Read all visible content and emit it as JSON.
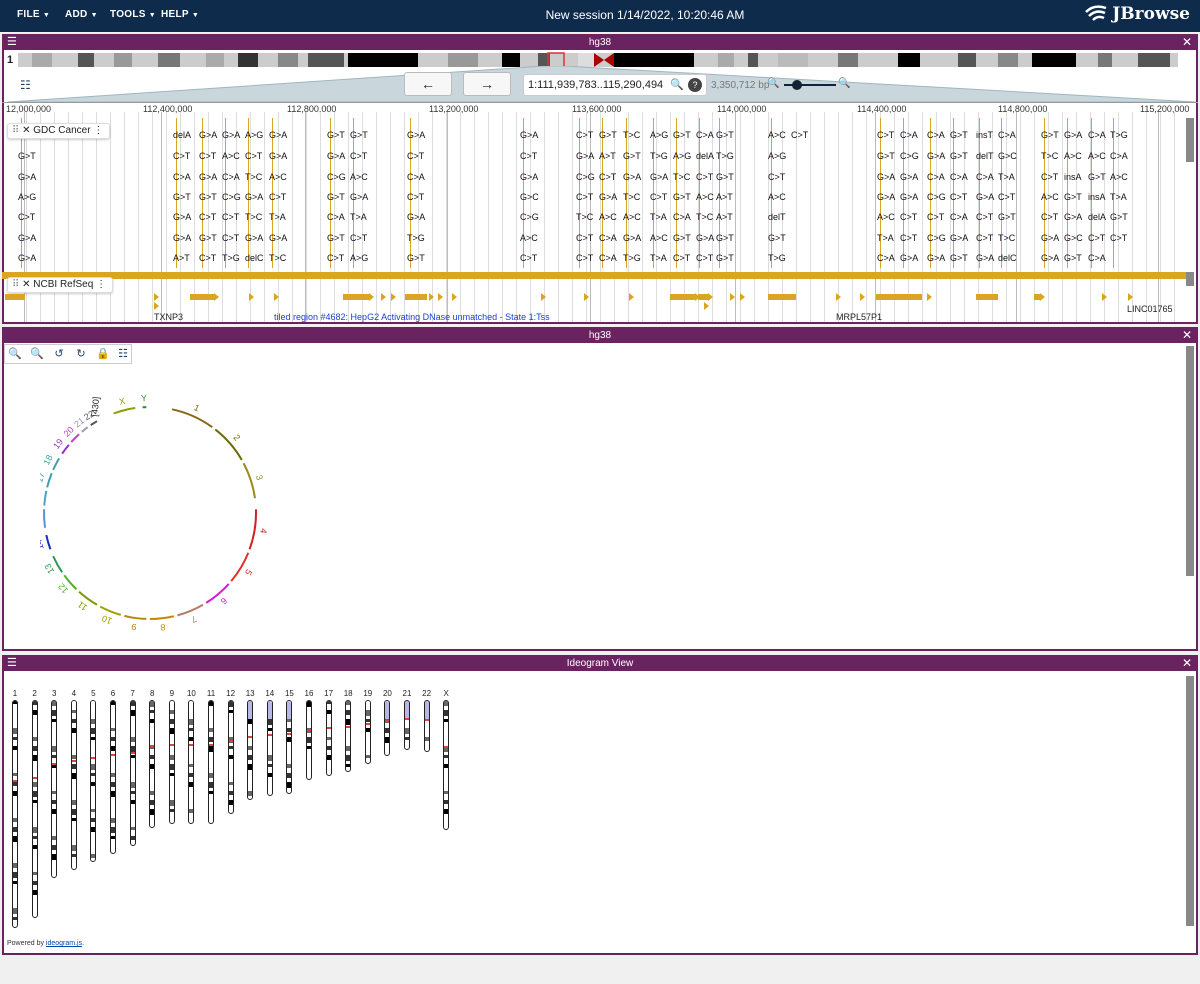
{
  "app": {
    "title": "New session 1/14/2022, 10:20:46 AM",
    "logo": "JBrowse"
  },
  "menus": [
    {
      "label": "FILE"
    },
    {
      "label": "ADD"
    },
    {
      "label": "TOOLS"
    },
    {
      "label": "HELP"
    }
  ],
  "linear_view": {
    "assembly": "hg38",
    "chrom": "1",
    "location": "1:111,939,783..115,290,494",
    "bp_width": "3,350,712 bp",
    "ruler": [
      "12,000,000",
      "112,400,000",
      "112,800,000",
      "113,200,000",
      "113,600,000",
      "114,000,000",
      "114,400,000",
      "114,800,000",
      "115,200,000"
    ],
    "tracks": [
      {
        "label": "GDC Cancer"
      },
      {
        "label": "NCBI RefSeq"
      }
    ],
    "mutation_rows": [
      [
        "delA",
        "G>A",
        "G>A",
        "A>G",
        "G>A",
        "G>T",
        "G>T",
        "G>A",
        "G>A",
        "C>T",
        "G>T",
        "T>C",
        "A>G",
        "G>T",
        "C>A",
        "G>T",
        "A>C",
        "C>T",
        "C>T",
        "C>A",
        "C>A",
        "G>T",
        "insT",
        "C>A",
        "G>T",
        "G>A",
        "C>A",
        "T>G"
      ],
      [
        "G>T",
        "C>T",
        "C>T",
        "A>C",
        "C>T",
        "G>A",
        "G>A",
        "C>T",
        "C>T",
        "C>T",
        "G>A",
        "A>T",
        "G>T",
        "T>G",
        "A>G",
        "delA",
        "T>G",
        "A>G",
        "G>T",
        "C>G",
        "G>A",
        "G>T",
        "delT",
        "G>C",
        "T>C",
        "A>C",
        "A>C",
        "C>A"
      ],
      [
        "G>A",
        "C>A",
        "G>A",
        "C>A",
        "T>C",
        "A>C",
        "C>G",
        "A>C",
        "C>A",
        "G>A",
        "C>G",
        "C>T",
        "G>A",
        "G>A",
        "T>C",
        "C>T",
        "G>T",
        "C>T",
        "G>A",
        "G>A",
        "C>A",
        "C>A",
        "C>A",
        "T>A",
        "C>T",
        "insA",
        "G>T",
        "A>C"
      ],
      [
        "A>G",
        "G>T",
        "G>T",
        "C>G",
        "G>A",
        "C>T",
        "G>T",
        "G>A",
        "C>T",
        "G>C",
        "C>T",
        "G>A",
        "T>C",
        "C>T",
        "G>T",
        "A>C",
        "A>T",
        "A>C",
        "G>A",
        "G>A",
        "C>G",
        "C>T",
        "G>A",
        "C>T",
        "A>C",
        "G>T",
        "insA",
        "T>A"
      ],
      [
        "C>T",
        "G>A",
        "C>T",
        "C>T",
        "T>C",
        "T>A",
        "C>A",
        "T>A",
        "G>A",
        "C>G",
        "T>C",
        "A>C",
        "A>C",
        "T>A",
        "C>A",
        "T>C",
        "A>T",
        "delT",
        "A>C",
        "C>T",
        "C>T",
        "C>A",
        "C>T",
        "G>T",
        "C>T",
        "G>A",
        "delA",
        "G>T"
      ],
      [
        "G>A",
        "G>A",
        "G>T",
        "C>T",
        "G>A",
        "G>A",
        "G>T",
        "C>T",
        "T>G",
        "A>C",
        "C>T",
        "C>A",
        "G>A",
        "A>C",
        "G>T",
        "G>A",
        "G>T",
        "G>T",
        "T>A",
        "C>T",
        "C>G",
        "G>A",
        "C>T",
        "T>C",
        "G>A",
        "G>C",
        "C>T",
        "C>T"
      ],
      [
        "G>A",
        "A>T",
        "C>T",
        "T>G",
        "delC",
        "T>C",
        "C>T",
        "A>G",
        "G>T",
        "C>T",
        "C>T",
        "C>A",
        "T>G",
        "T>A",
        "C>T",
        "C>T",
        "G>T",
        "T>G",
        "C>A",
        "G>A",
        "G>A",
        "G>T",
        "G>A",
        "delC",
        "G>A",
        "G>T",
        "C>A"
      ]
    ],
    "genes": [
      "TXNP3",
      "tiled region #4682: HepG2 Activating DNase unmatched - State 1:Tss",
      "MRPL57P1",
      "LINC01765"
    ]
  },
  "circular_view": {
    "title": "hg38",
    "chromosomes": [
      "1",
      "2",
      "3",
      "4",
      "5",
      "6",
      "7",
      "8",
      "9",
      "10",
      "11",
      "12",
      "13",
      "14",
      "15",
      "16",
      "17",
      "18",
      "19",
      "20",
      "21",
      "22",
      "X",
      "Y"
    ],
    "extra_label": "[430]"
  },
  "ideogram_view": {
    "title": "Ideogram View",
    "chromosomes": [
      "1",
      "2",
      "3",
      "4",
      "5",
      "6",
      "7",
      "8",
      "9",
      "10",
      "11",
      "12",
      "13",
      "14",
      "15",
      "16",
      "17",
      "18",
      "19",
      "20",
      "21",
      "22",
      "X"
    ],
    "powered_prefix": "Powered by ",
    "powered_link": "ideogram.js",
    "powered_suffix": "."
  },
  "colors": {
    "topbar": "#0f2b4c",
    "view_header": "#6b2260",
    "feature": "#daa520"
  }
}
